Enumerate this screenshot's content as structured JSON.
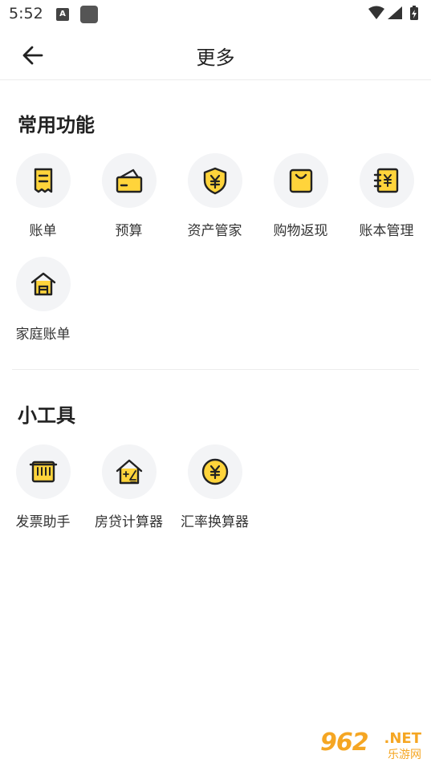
{
  "status_bar": {
    "time": "5:52",
    "notif_letter": "A"
  },
  "header": {
    "title": "更多"
  },
  "sections": [
    {
      "title": "常用功能",
      "items": [
        {
          "label": "账单",
          "icon": "bill-icon"
        },
        {
          "label": "预算",
          "icon": "budget-wallet-icon"
        },
        {
          "label": "资产管家",
          "icon": "asset-shield-icon"
        },
        {
          "label": "购物返现",
          "icon": "shopping-bag-icon"
        },
        {
          "label": "账本管理",
          "icon": "ledger-book-icon"
        },
        {
          "label": "家庭账单",
          "icon": "home-icon"
        }
      ]
    },
    {
      "title": "小工具",
      "items": [
        {
          "label": "发票助手",
          "icon": "invoice-icon"
        },
        {
          "label": "房贷计算器",
          "icon": "mortgage-calculator-icon"
        },
        {
          "label": "汇率换算器",
          "icon": "currency-exchange-icon"
        }
      ]
    }
  ],
  "watermark": {
    "number": "962",
    "domain": ".NET",
    "subtitle": "乐游网"
  },
  "colors": {
    "accent": "#FFD43B",
    "stroke": "#222222",
    "circle_bg": "#F3F4F6"
  }
}
